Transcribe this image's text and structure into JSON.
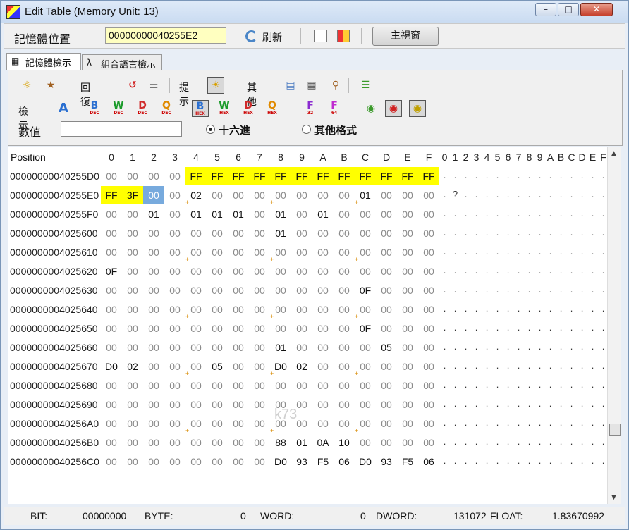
{
  "window": {
    "title": "Edit Table (Memory Unit: 13)"
  },
  "toolbar": {
    "address_label": "記憶體位置",
    "address_value": "00000000040255E2",
    "refresh_label": "刷新",
    "main_window_label": "主視窗"
  },
  "tabs": [
    {
      "label": "記憶體檢示",
      "active": true,
      "icon": "memory-icon"
    },
    {
      "label": "組合語言檢示",
      "active": false,
      "icon": "asm-icon"
    }
  ],
  "panel": {
    "undo_label": "回復",
    "hint_label": "提示",
    "other_label": "其他",
    "view_label": "檢示",
    "value_label": "數值",
    "value_input": "",
    "hex_radio": "十六進",
    "other_format_radio": "其他格式",
    "format_buttons": [
      {
        "letter": "B",
        "sub": "DEC",
        "color": "#2a6fd1"
      },
      {
        "letter": "W",
        "sub": "DEC",
        "color": "#1a9a2a"
      },
      {
        "letter": "D",
        "sub": "DEC",
        "color": "#d02a2a"
      },
      {
        "letter": "Q",
        "sub": "DEC",
        "color": "#e08a00"
      },
      {
        "letter": "B",
        "sub": "HEX",
        "color": "#2a6fd1"
      },
      {
        "letter": "W",
        "sub": "HEX",
        "color": "#1a9a2a"
      },
      {
        "letter": "D",
        "sub": "HEX",
        "color": "#d02a2a"
      },
      {
        "letter": "Q",
        "sub": "HEX",
        "color": "#e08a00"
      },
      {
        "letter": "F",
        "sub": "32",
        "color": "#8a2ad0"
      },
      {
        "letter": "F",
        "sub": "64",
        "color": "#c02ad0"
      }
    ]
  },
  "grid": {
    "position_header": "Position",
    "hex_headers": [
      "0",
      "1",
      "2",
      "3",
      "4",
      "5",
      "6",
      "7",
      "8",
      "9",
      "A",
      "B",
      "C",
      "D",
      "E",
      "F"
    ],
    "ascii_headers": [
      "0",
      "1",
      "2",
      "3",
      "4",
      "5",
      "6",
      "7",
      "8",
      "9",
      "A",
      "B",
      "C",
      "D",
      "E",
      "F"
    ],
    "rows": [
      {
        "address": "00000000040255D0",
        "bytes": [
          "00",
          "00",
          "00",
          "00",
          "FF",
          "FF",
          "FF",
          "FF",
          "FF",
          "FF",
          "FF",
          "FF",
          "FF",
          "FF",
          "FF",
          "FF"
        ],
        "ascii": [
          ".",
          ".",
          ".",
          ".",
          ".",
          ".",
          ".",
          ".",
          ".",
          ".",
          ".",
          ".",
          ".",
          ".",
          ".",
          "."
        ]
      },
      {
        "address": "00000000040255E0",
        "bytes": [
          "FF",
          "3F",
          "00",
          "00",
          "02",
          "00",
          "00",
          "00",
          "00",
          "00",
          "00",
          "00",
          "01",
          "00",
          "00",
          "00"
        ],
        "ascii": [
          ".",
          "?",
          ".",
          ".",
          ".",
          ".",
          ".",
          ".",
          ".",
          ".",
          ".",
          ".",
          ".",
          ".",
          ".",
          "."
        ]
      },
      {
        "address": "00000000040255F0",
        "bytes": [
          "00",
          "00",
          "01",
          "00",
          "01",
          "01",
          "01",
          "00",
          "01",
          "00",
          "01",
          "00",
          "00",
          "00",
          "00",
          "00"
        ],
        "ascii": [
          ".",
          ".",
          ".",
          ".",
          ".",
          ".",
          ".",
          ".",
          ".",
          ".",
          ".",
          ".",
          ".",
          ".",
          ".",
          "."
        ]
      },
      {
        "address": "0000000004025600",
        "bytes": [
          "00",
          "00",
          "00",
          "00",
          "00",
          "00",
          "00",
          "00",
          "01",
          "00",
          "00",
          "00",
          "00",
          "00",
          "00",
          "00"
        ],
        "ascii": [
          ".",
          ".",
          ".",
          ".",
          ".",
          ".",
          ".",
          ".",
          ".",
          ".",
          ".",
          ".",
          ".",
          ".",
          ".",
          "."
        ]
      },
      {
        "address": "0000000004025610",
        "bytes": [
          "00",
          "00",
          "00",
          "00",
          "00",
          "00",
          "00",
          "00",
          "00",
          "00",
          "00",
          "00",
          "00",
          "00",
          "00",
          "00"
        ],
        "ascii": [
          ".",
          ".",
          ".",
          ".",
          ".",
          ".",
          ".",
          ".",
          ".",
          ".",
          ".",
          ".",
          ".",
          ".",
          ".",
          "."
        ]
      },
      {
        "address": "0000000004025620",
        "bytes": [
          "0F",
          "00",
          "00",
          "00",
          "00",
          "00",
          "00",
          "00",
          "00",
          "00",
          "00",
          "00",
          "00",
          "00",
          "00",
          "00"
        ],
        "ascii": [
          ".",
          ".",
          ".",
          ".",
          ".",
          ".",
          ".",
          ".",
          ".",
          ".",
          ".",
          ".",
          ".",
          ".",
          ".",
          "."
        ]
      },
      {
        "address": "0000000004025630",
        "bytes": [
          "00",
          "00",
          "00",
          "00",
          "00",
          "00",
          "00",
          "00",
          "00",
          "00",
          "00",
          "00",
          "0F",
          "00",
          "00",
          "00"
        ],
        "ascii": [
          ".",
          ".",
          ".",
          ".",
          ".",
          ".",
          ".",
          ".",
          ".",
          ".",
          ".",
          ".",
          ".",
          ".",
          ".",
          "."
        ]
      },
      {
        "address": "0000000004025640",
        "bytes": [
          "00",
          "00",
          "00",
          "00",
          "00",
          "00",
          "00",
          "00",
          "00",
          "00",
          "00",
          "00",
          "00",
          "00",
          "00",
          "00"
        ],
        "ascii": [
          ".",
          ".",
          ".",
          ".",
          ".",
          ".",
          ".",
          ".",
          ".",
          ".",
          ".",
          ".",
          ".",
          ".",
          ".",
          "."
        ]
      },
      {
        "address": "0000000004025650",
        "bytes": [
          "00",
          "00",
          "00",
          "00",
          "00",
          "00",
          "00",
          "00",
          "00",
          "00",
          "00",
          "00",
          "0F",
          "00",
          "00",
          "00"
        ],
        "ascii": [
          ".",
          ".",
          ".",
          ".",
          ".",
          ".",
          ".",
          ".",
          ".",
          ".",
          ".",
          ".",
          ".",
          ".",
          ".",
          "."
        ]
      },
      {
        "address": "0000000004025660",
        "bytes": [
          "00",
          "00",
          "00",
          "00",
          "00",
          "00",
          "00",
          "00",
          "01",
          "00",
          "00",
          "00",
          "00",
          "05",
          "00",
          "00"
        ],
        "ascii": [
          ".",
          ".",
          ".",
          ".",
          ".",
          ".",
          ".",
          ".",
          ".",
          ".",
          ".",
          ".",
          ".",
          ".",
          ".",
          "."
        ]
      },
      {
        "address": "0000000004025670",
        "bytes": [
          "D0",
          "02",
          "00",
          "00",
          "00",
          "05",
          "00",
          "00",
          "D0",
          "02",
          "00",
          "00",
          "00",
          "00",
          "00",
          "00"
        ],
        "ascii": [
          ".",
          ".",
          ".",
          ".",
          ".",
          ".",
          ".",
          ".",
          ".",
          ".",
          ".",
          ".",
          ".",
          ".",
          ".",
          "."
        ]
      },
      {
        "address": "0000000004025680",
        "bytes": [
          "00",
          "00",
          "00",
          "00",
          "00",
          "00",
          "00",
          "00",
          "00",
          "00",
          "00",
          "00",
          "00",
          "00",
          "00",
          "00"
        ],
        "ascii": [
          ".",
          ".",
          ".",
          ".",
          ".",
          ".",
          ".",
          ".",
          ".",
          ".",
          ".",
          ".",
          ".",
          ".",
          ".",
          "."
        ]
      },
      {
        "address": "0000000004025690",
        "bytes": [
          "00",
          "00",
          "00",
          "00",
          "00",
          "00",
          "00",
          "00",
          "00",
          "00",
          "00",
          "00",
          "00",
          "00",
          "00",
          "00"
        ],
        "ascii": [
          ".",
          ".",
          ".",
          ".",
          ".",
          ".",
          ".",
          ".",
          ".",
          ".",
          ".",
          ".",
          ".",
          ".",
          ".",
          "."
        ]
      },
      {
        "address": "00000000040256A0",
        "bytes": [
          "00",
          "00",
          "00",
          "00",
          "00",
          "00",
          "00",
          "00",
          "00",
          "00",
          "00",
          "00",
          "00",
          "00",
          "00",
          "00"
        ],
        "ascii": [
          ".",
          ".",
          ".",
          ".",
          ".",
          ".",
          ".",
          ".",
          ".",
          ".",
          ".",
          ".",
          ".",
          ".",
          ".",
          "."
        ]
      },
      {
        "address": "00000000040256B0",
        "bytes": [
          "00",
          "00",
          "00",
          "00",
          "00",
          "00",
          "00",
          "00",
          "88",
          "01",
          "0A",
          "10",
          "00",
          "00",
          "00",
          "00"
        ],
        "ascii": [
          ".",
          ".",
          ".",
          ".",
          ".",
          ".",
          ".",
          ".",
          ".",
          ".",
          ".",
          ".",
          ".",
          ".",
          ".",
          "."
        ]
      },
      {
        "address": "00000000040256C0",
        "bytes": [
          "00",
          "00",
          "00",
          "00",
          "00",
          "00",
          "00",
          "00",
          "D0",
          "93",
          "F5",
          "06",
          "D0",
          "93",
          "F5",
          "06"
        ],
        "ascii": [
          ".",
          ".",
          ".",
          ".",
          ".",
          ".",
          ".",
          ".",
          ".",
          ".",
          ".",
          ".",
          ".",
          ".",
          ".",
          "."
        ]
      }
    ]
  },
  "status": {
    "bit_label": "BIT:",
    "bit_value": "00000000",
    "byte_label": "BYTE:",
    "byte_value": "0",
    "word_label": "WORD:",
    "word_value": "0",
    "dword_label": "DWORD:",
    "dword_value": "131072",
    "float_label": "FLOAT:",
    "float_value": "1.83670992"
  },
  "watermark": "k73",
  "colors": {
    "highlight": "#ffff00",
    "selection": "#77aadd",
    "address_bg": "#ffffc0"
  }
}
